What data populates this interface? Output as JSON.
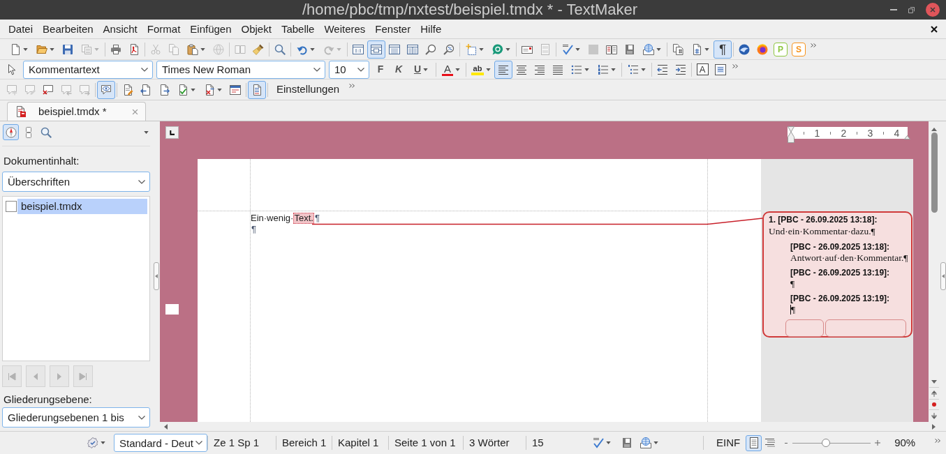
{
  "window": {
    "title": "/home/pbc/tmp/nxtest/beispiel.tmdx * - TextMaker"
  },
  "menu_bar": [
    {
      "label": "Datei"
    },
    {
      "label": "Bearbeiten"
    },
    {
      "label": "Ansicht"
    },
    {
      "label": "Format"
    },
    {
      "label": "Einfügen"
    },
    {
      "label": "Objekt"
    },
    {
      "label": "Tabelle"
    },
    {
      "label": "Weiteres"
    },
    {
      "label": "Fenster"
    },
    {
      "label": "Hilfe"
    }
  ],
  "standard_toolbar": [
    {
      "kind": "icon",
      "on": false,
      "disabled": false
    },
    {
      "kind": "icon",
      "on": false,
      "disabled": false
    },
    {
      "kind": "icon",
      "on": false,
      "disabled": false
    },
    {
      "kind": "icon",
      "on": false,
      "disabled": true
    },
    {
      "kind": "icon",
      "on": false,
      "disabled": false
    },
    {
      "kind": "icon",
      "on": false,
      "disabled": false
    },
    {
      "kind": "icon",
      "on": false,
      "disabled": true
    },
    {
      "kind": "icon",
      "on": false,
      "disabled": true
    },
    {
      "kind": "icon",
      "on": false,
      "disabled": false
    },
    {
      "kind": "icon",
      "on": false,
      "disabled": true
    },
    {
      "kind": "icon",
      "on": false,
      "disabled": true
    },
    {
      "kind": "icon",
      "on": false,
      "disabled": false
    },
    {
      "kind": "icon",
      "on": false,
      "disabled": false
    },
    {
      "kind": "icon",
      "on": false,
      "disabled": false
    },
    {
      "kind": "icon",
      "on": false,
      "disabled": true
    },
    {
      "kind": "icon",
      "on": false,
      "disabled": false
    },
    {
      "kind": "icon",
      "on": true,
      "disabled": false
    },
    {
      "kind": "icon",
      "on": false,
      "disabled": false
    },
    {
      "kind": "icon",
      "on": false,
      "disabled": false
    },
    {
      "kind": "icon",
      "on": false,
      "disabled": false
    },
    {
      "kind": "icon",
      "on": false,
      "disabled": false
    },
    {
      "kind": "icon",
      "on": false,
      "disabled": false
    },
    {
      "kind": "icon",
      "on": false,
      "disabled": false
    },
    {
      "kind": "icon",
      "on": false,
      "disabled": false
    },
    {
      "kind": "icon",
      "on": false,
      "disabled": true
    },
    {
      "kind": "icon",
      "on": false,
      "disabled": false
    },
    {
      "kind": "icon",
      "on": false,
      "disabled": true
    },
    {
      "kind": "icon",
      "on": false,
      "disabled": false
    },
    {
      "kind": "icon",
      "on": false,
      "disabled": false
    },
    {
      "kind": "icon",
      "on": false,
      "disabled": false
    },
    {
      "kind": "icon",
      "on": false,
      "disabled": false
    },
    {
      "kind": "icon",
      "on": false,
      "disabled": false
    },
    {
      "kind": "text",
      "label": "¶",
      "on": true,
      "disabled": false
    },
    {
      "kind": "icon",
      "on": false,
      "disabled": false
    },
    {
      "kind": "icon",
      "on": false,
      "disabled": false
    },
    {
      "kind": "tile",
      "label": "P",
      "color": "#8dc63f",
      "on": false,
      "disabled": false
    },
    {
      "kind": "tile",
      "label": "S",
      "color": "#f7941d",
      "on": false,
      "disabled": false
    }
  ],
  "formatting_toolbar": {
    "paragraph_style": "Kommentartext",
    "font": "Times New Roman",
    "font_size": "10",
    "buttons": [
      {
        "kind": "bold",
        "label": "F",
        "on": false,
        "disabled": false
      },
      {
        "kind": "italic",
        "label": "K",
        "on": false,
        "disabled": false
      },
      {
        "kind": "underline",
        "label": "U",
        "on": false,
        "disabled": false
      },
      {
        "kind": "color",
        "label": "A",
        "on": false,
        "disabled": false
      },
      {
        "kind": "highlight",
        "label": "ab",
        "on": false,
        "disabled": false
      },
      {
        "kind": "icon",
        "on": true,
        "disabled": false
      },
      {
        "kind": "icon",
        "on": false,
        "disabled": false
      },
      {
        "kind": "icon",
        "on": false,
        "disabled": false
      },
      {
        "kind": "icon",
        "on": false,
        "disabled": false
      },
      {
        "kind": "icon",
        "on": false,
        "disabled": false
      },
      {
        "kind": "icon",
        "on": false,
        "disabled": false
      },
      {
        "kind": "icon",
        "on": false,
        "disabled": false
      },
      {
        "kind": "icon",
        "on": false,
        "disabled": false
      },
      {
        "kind": "icon",
        "on": false,
        "disabled": false
      },
      {
        "kind": "boxed",
        "label": "A",
        "on": false,
        "disabled": false
      },
      {
        "kind": "icon",
        "on": false,
        "disabled": false
      }
    ]
  },
  "comment_toolbar": [
    {
      "kind": "icon",
      "on": false,
      "disabled": true
    },
    {
      "kind": "icon",
      "on": false,
      "disabled": true
    },
    {
      "kind": "icon",
      "on": false,
      "disabled": false
    },
    {
      "kind": "icon",
      "on": false,
      "disabled": true
    },
    {
      "kind": "icon",
      "on": false,
      "disabled": true
    },
    {
      "kind": "icon",
      "on": true,
      "disabled": false
    },
    {
      "kind": "icon",
      "on": false,
      "disabled": false
    },
    {
      "kind": "icon",
      "on": false,
      "disabled": false
    },
    {
      "kind": "icon",
      "on": false,
      "disabled": false
    },
    {
      "kind": "icon",
      "on": false,
      "disabled": false
    },
    {
      "kind": "icon",
      "on": false,
      "disabled": false
    },
    {
      "kind": "icon",
      "on": false,
      "disabled": false
    },
    {
      "kind": "icon",
      "on": true,
      "disabled": false
    },
    {
      "kind": "label",
      "label": "Einstellungen",
      "on": false,
      "disabled": false
    }
  ],
  "tabs": [
    {
      "label": "beispiel.tmdx *",
      "selected": true
    }
  ],
  "sidebar": {
    "modes": [
      {
        "selected": true
      },
      {
        "selected": false
      },
      {
        "selected": false
      }
    ],
    "content_label": "Dokumentinhalt:",
    "content_select": "Überschriften",
    "tree": [
      {
        "label": "beispiel.tmdx",
        "checked": false,
        "selected": true
      }
    ],
    "nav_buttons": [
      {
        "disabled": true
      },
      {
        "disabled": true
      },
      {
        "disabled": true
      },
      {
        "disabled": true
      }
    ],
    "level_label": "Gliederungsebene:",
    "level_select": "Gliederungsebenen 1 bis"
  },
  "ruler": {
    "numbers": [
      "1",
      "2",
      "3",
      "4"
    ]
  },
  "document": {
    "paragraphs": [
      {
        "text": "Ein·wenig·",
        "anchor": "Text.",
        "mark": "¶"
      },
      {
        "mark": "¶"
      }
    ]
  },
  "comments": [
    {
      "header": "1. [PBC - 26.09.2025 13:18]:",
      "text": "Und·ein·Kommentar·dazu.¶",
      "cursor": false,
      "children": [
        {
          "header": "[PBC - 26.09.2025 13:18]:",
          "text": "Antwort·auf·den·Kommentar.¶",
          "cursor": false
        },
        {
          "header": "[PBC - 26.09.2025 13:19]:",
          "text": "¶",
          "cursor": false
        },
        {
          "header": "[PBC - 26.09.2025 13:19]:",
          "text": "¶",
          "cursor": true
        }
      ]
    }
  ],
  "status_bar": {
    "language": "Standard - Deut",
    "cells": [
      "Ze 1 Sp 1",
      "Bereich 1",
      "Kapitel 1",
      "Seite 1 von 1",
      "3 Wörter",
      "15"
    ],
    "mode": "EINF",
    "views": [
      {
        "selected": true
      },
      {
        "selected": false
      }
    ],
    "zoom": {
      "level": 0.43,
      "reading": "90%"
    }
  }
}
